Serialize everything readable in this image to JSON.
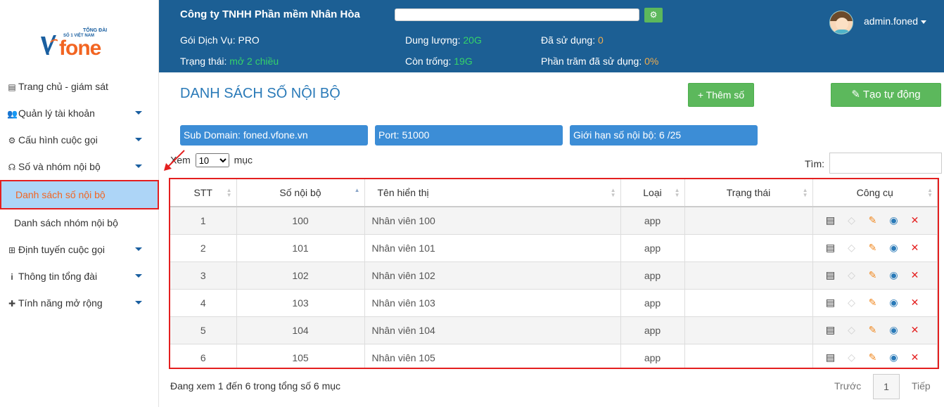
{
  "logo": {
    "brand": "fone",
    "tagline_top": "TỔNG ĐÀI",
    "tagline_bottom": "SỐ 1 VIỆT NAM"
  },
  "sidebar": {
    "items": [
      {
        "icon": "clipboard-icon",
        "label": "Trang chủ - giám sát"
      },
      {
        "icon": "users-icon",
        "label": "Quản lý tài khoản"
      },
      {
        "icon": "gears-icon",
        "label": "Cấu hình cuộc gọi"
      },
      {
        "icon": "headset-icon",
        "label": "Số và nhóm nội bộ"
      },
      {
        "icon": "",
        "label": "Danh sách số nội bộ"
      },
      {
        "icon": "",
        "label": "Danh sách nhóm nội bộ"
      },
      {
        "icon": "sitemap-icon",
        "label": "Định tuyến cuộc gọi"
      },
      {
        "icon": "info-icon",
        "label": "Thông tin tổng đài"
      },
      {
        "icon": "puzzle-icon",
        "label": "Tính năng mở rộng"
      }
    ]
  },
  "header": {
    "company": "Công ty TNHH Phần mềm Nhân Hòa",
    "service_label": "Gói Dịch Vụ:",
    "service_value": "PRO",
    "status_label": "Trạng thái:",
    "status_value": "mở 2 chiều",
    "capacity_label": "Dung lượng:",
    "capacity_value": "20G",
    "free_label": "Còn trống:",
    "free_value": "19G",
    "used_label": "Đã sử dụng:",
    "used_value": "0",
    "percent_label": "Phần trăm đã sử dụng:",
    "percent_value": "0%",
    "user": "admin.foned"
  },
  "main": {
    "title": "DANH SÁCH SỐ NỘI BỘ",
    "add_button": "+ Thêm số",
    "auto_button": "Tạo tự động",
    "subdomain_label": "Sub Domain:",
    "subdomain_value": "foned.vfone.vn",
    "port_label": "Port:",
    "port_value": "51000",
    "limit_label": "Giới hạn số nội bộ:",
    "limit_value": "6",
    "limit_max": "/25",
    "show_label": "Xem",
    "show_value": "10",
    "show_suffix": "mục",
    "find_label": "Tìm:"
  },
  "table": {
    "headers": [
      "STT",
      "Số nội bộ",
      "Tên hiển thị",
      "Loại",
      "Trạng thái",
      "Công cụ"
    ],
    "rows": [
      {
        "stt": "1",
        "number": "100",
        "name": "Nhân viên 100",
        "type": "app",
        "status": ""
      },
      {
        "stt": "2",
        "number": "101",
        "name": "Nhân viên 101",
        "type": "app",
        "status": ""
      },
      {
        "stt": "3",
        "number": "102",
        "name": "Nhân viên 102",
        "type": "app",
        "status": ""
      },
      {
        "stt": "4",
        "number": "103",
        "name": "Nhân viên 103",
        "type": "app",
        "status": ""
      },
      {
        "stt": "5",
        "number": "104",
        "name": "Nhân viên 104",
        "type": "app",
        "status": ""
      },
      {
        "stt": "6",
        "number": "105",
        "name": "Nhân viên 105",
        "type": "app",
        "status": ""
      }
    ]
  },
  "footer": {
    "info": "Đang xem 1 đến 6 trong tổng số 6 mục",
    "prev": "Trước",
    "page": "1",
    "next": "Tiếp"
  },
  "colors": {
    "header_bg": "#1c5f94",
    "accent_green": "#5cb85c",
    "chip_blue": "#3c8dd6",
    "highlight_red": "#e41f1f",
    "active_orange": "#f26522"
  }
}
